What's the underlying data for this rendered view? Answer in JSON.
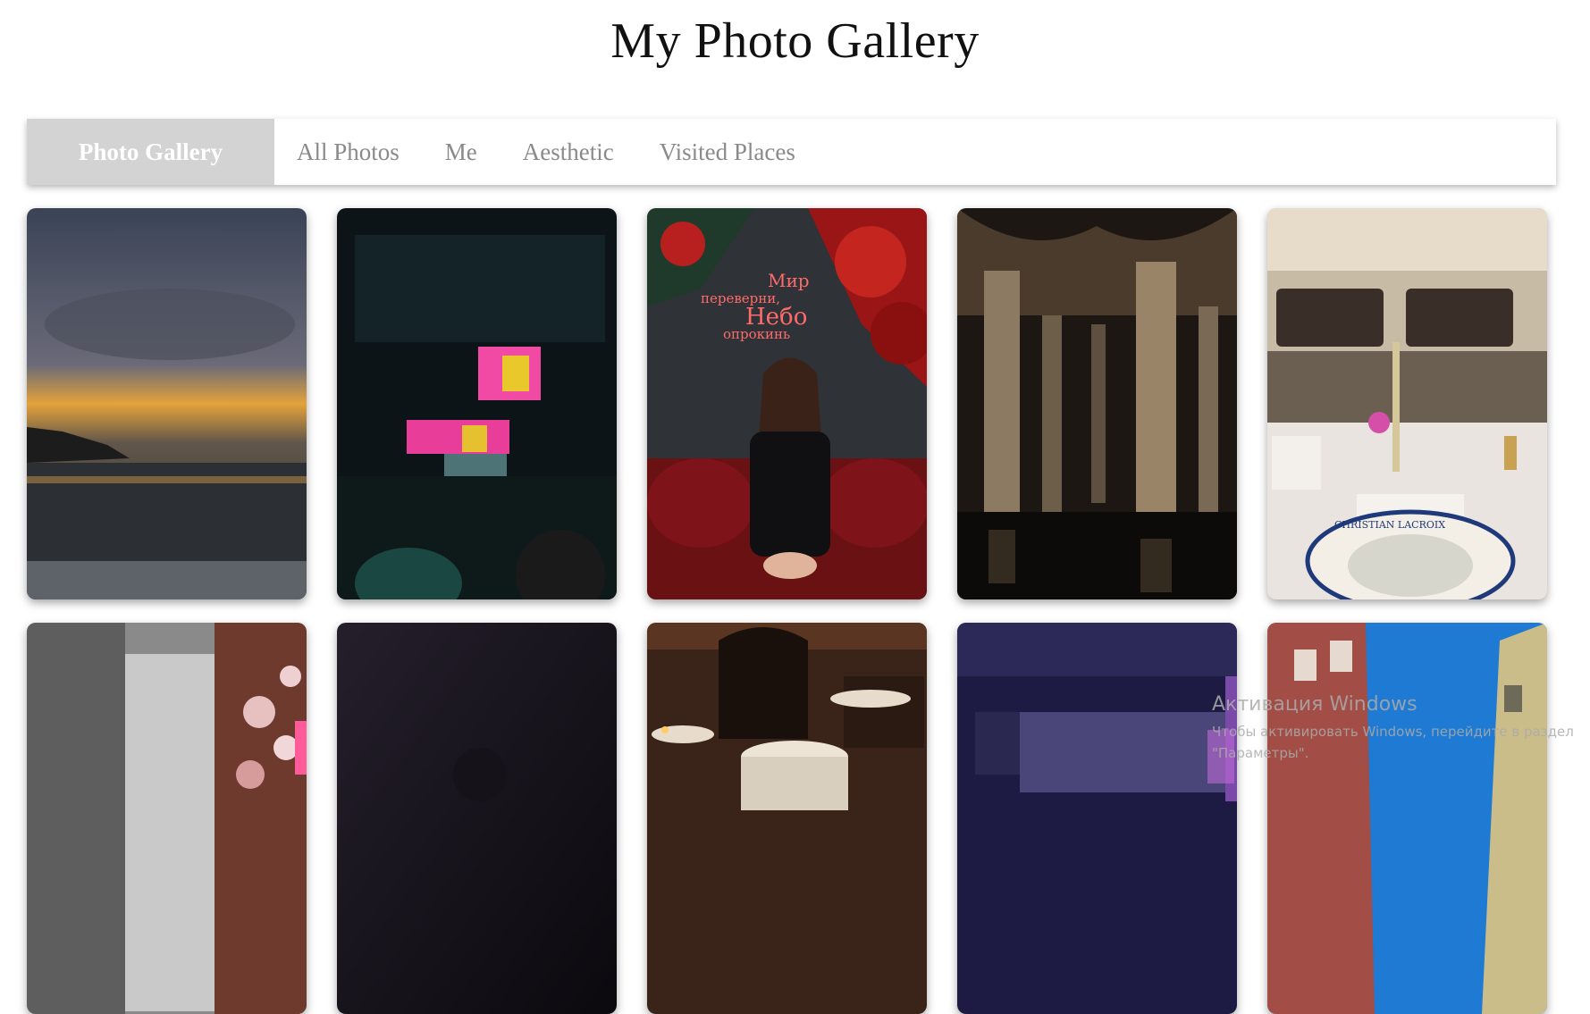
{
  "page": {
    "title": "My Photo Gallery"
  },
  "navbar": {
    "brand": "Photo Gallery",
    "links": [
      "All Photos",
      "Me",
      "Aesthetic",
      "Visited Places"
    ]
  },
  "photos": [
    {
      "name": "sea-sunset-photo"
    },
    {
      "name": "concert-arena-photo"
    },
    {
      "name": "girl-neon-sign-photo",
      "sign_text": [
        "Мир",
        "переверни,",
        "Небо",
        "опрокинь"
      ]
    },
    {
      "name": "cistern-columns-photo"
    },
    {
      "name": "restaurant-table-photo",
      "plate_text": "CHRISTIAN LACROIX"
    },
    {
      "name": "flower-wall-photo"
    },
    {
      "name": "dark-room-photo"
    },
    {
      "name": "restaurant-interior-photo"
    },
    {
      "name": "purple-hall-photo"
    },
    {
      "name": "street-sky-photo"
    }
  ],
  "watermark": {
    "title": "Активация Windows",
    "subtitle_line1": "Чтобы активировать Windows, перейдите в раздел",
    "subtitle_line2": "\"Параметры\"."
  }
}
